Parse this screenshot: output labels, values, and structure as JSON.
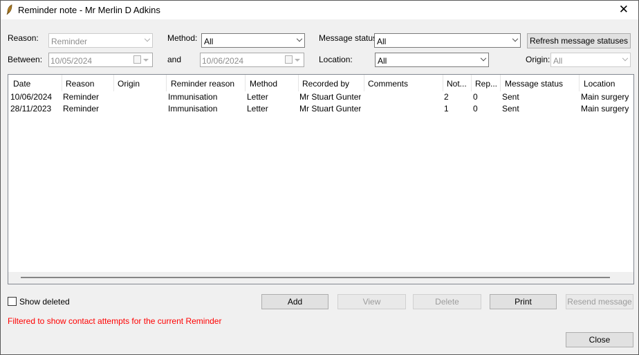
{
  "window": {
    "title": "Reminder note - Mr Merlin D Adkins",
    "close": "✕"
  },
  "filters": {
    "reason_label": "Reason:",
    "reason_value": "Reminder",
    "method_label": "Method:",
    "method_value": "All",
    "message_status_label": "Message status:",
    "message_status_value": "All",
    "refresh_button": "Refresh message statuses",
    "between_label": "Between:",
    "from_date": "10/05/2024",
    "and_label": "and",
    "to_date": "10/06/2024",
    "location_label": "Location:",
    "location_value": "All",
    "origin_label": "Origin:",
    "origin_value": "All"
  },
  "table": {
    "columns": [
      "Date",
      "Reason",
      "Origin",
      "Reminder reason",
      "Method",
      "Recorded by",
      "Comments",
      "Not...",
      "Rep...",
      "Message status",
      "Location"
    ],
    "rows": [
      [
        "10/06/2024",
        "Reminder",
        "",
        "Immunisation",
        "Letter",
        "Mr Stuart Gunter",
        "",
        "2",
        "0",
        "Sent",
        "Main surgery"
      ],
      [
        "28/11/2023",
        "Reminder",
        "",
        "Immunisation",
        "Letter",
        "Mr Stuart Gunter",
        "",
        "1",
        "0",
        "Sent",
        "Main surgery"
      ]
    ]
  },
  "footer": {
    "show_deleted_label": "Show deleted",
    "add_button": "Add",
    "view_button": "View",
    "delete_button": "Delete",
    "print_button": "Print",
    "resend_button": "Resend message",
    "filter_notice": "Filtered to show contact attempts for the current Reminder",
    "close_button": "Close"
  }
}
